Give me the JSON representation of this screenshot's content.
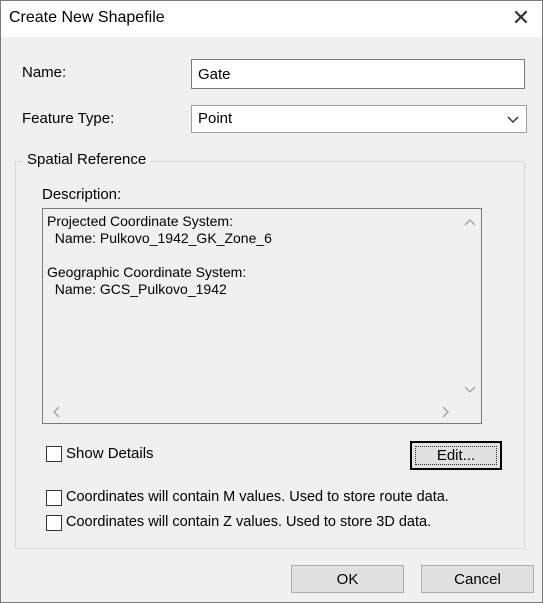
{
  "dialog": {
    "title": "Create New Shapefile",
    "close_glyph": "✕"
  },
  "form": {
    "name_label": "Name:",
    "name_value": "Gate",
    "feature_type_label": "Feature Type:",
    "feature_type_value": "Point"
  },
  "spatial_reference": {
    "group_label": "Spatial Reference",
    "description_label": "Description:",
    "description_lines": [
      "Projected Coordinate System:",
      "  Name: Pulkovo_1942_GK_Zone_6",
      "",
      "Geographic Coordinate System:",
      "  Name: GCS_Pulkovo_1942"
    ],
    "show_details_label": "Show Details",
    "show_details_checked": false,
    "edit_label": "Edit...",
    "m_values_label": "Coordinates will contain M values. Used to store route data.",
    "m_values_checked": false,
    "z_values_label": "Coordinates will contain Z values. Used to store 3D data.",
    "z_values_checked": false
  },
  "buttons": {
    "ok_label": "OK",
    "cancel_label": "Cancel"
  },
  "icons": {
    "close": "close-icon",
    "dropdown": "chevron-down-icon",
    "scroll_up": "chevron-up-icon",
    "scroll_down": "chevron-down-icon",
    "scroll_left": "chevron-left-icon",
    "scroll_right": "chevron-right-icon"
  }
}
